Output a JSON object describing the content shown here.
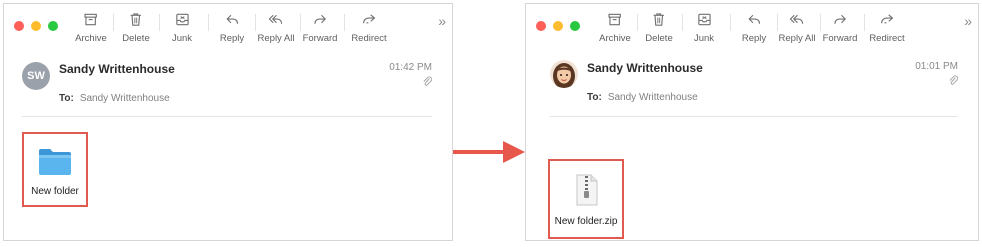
{
  "toolbar": {
    "archive": "Archive",
    "delete": "Delete",
    "junk": "Junk",
    "reply": "Reply",
    "reply_all": "Reply All",
    "forward": "Forward",
    "redirect": "Redirect",
    "more_icon": "chevron-double-right-icon"
  },
  "left_window": {
    "avatar_initials": "SW",
    "sender": "Sandy Writtenhouse",
    "to_label": "To:",
    "recipient": "Sandy Writtenhouse",
    "time": "01:42 PM",
    "attachment": {
      "name": "New folder",
      "icon": "folder-icon"
    }
  },
  "right_window": {
    "avatar": "memoji-avatar",
    "sender": "Sandy Writtenhouse",
    "to_label": "To:",
    "recipient": "Sandy Writtenhouse",
    "time": "01:01 PM",
    "attachment": {
      "name": "New folder.zip",
      "icon": "zip-file-icon"
    }
  },
  "colors": {
    "highlight": "#e05a4e",
    "arrow": "#e8574b",
    "folder": "#4aa8e8"
  }
}
